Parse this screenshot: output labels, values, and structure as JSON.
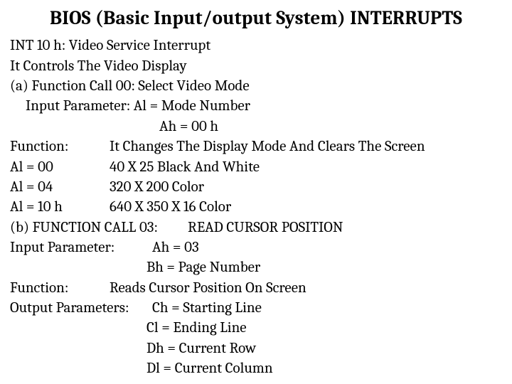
{
  "title": "BIOS (Basic Input/output System) INTERRUPTS",
  "lines": {
    "l1": "INT 10 h: Video Service Interrupt",
    "l2": "It Controls The Video Display",
    "l3": "(a) Function Call 00: Select Video Mode",
    "l4": "Input Parameter: Al = Mode Number",
    "l5": "Ah = 00 h",
    "fn_label": "Function:",
    "fn_val": "It Changes The Display Mode And Clears The Screen",
    "r1a": "Al = 00",
    "r1b": "40 X 25 Black And White",
    "r2a": "Al = 04",
    "r2b": "320 X 200 Color",
    "r3a": "Al = 10 h",
    "r3b": "640 X 350 X 16 Color",
    "l6a": "(b) FUNCTION CALL 03:",
    "l6b": "READ CURSOR POSITION",
    "ip_label": "Input Parameter:",
    "ip1": "Ah = 03",
    "ip2": "Bh = Page Number",
    "fn2_label": "Function:",
    "fn2_val": "Reads Cursor Position On Screen",
    "op_label": "Output Parameters:",
    "op1": "Ch = Starting Line",
    "op2": "Cl = Ending Line",
    "op3": "Dh = Current Row",
    "op4": "Dl = Current Column"
  }
}
